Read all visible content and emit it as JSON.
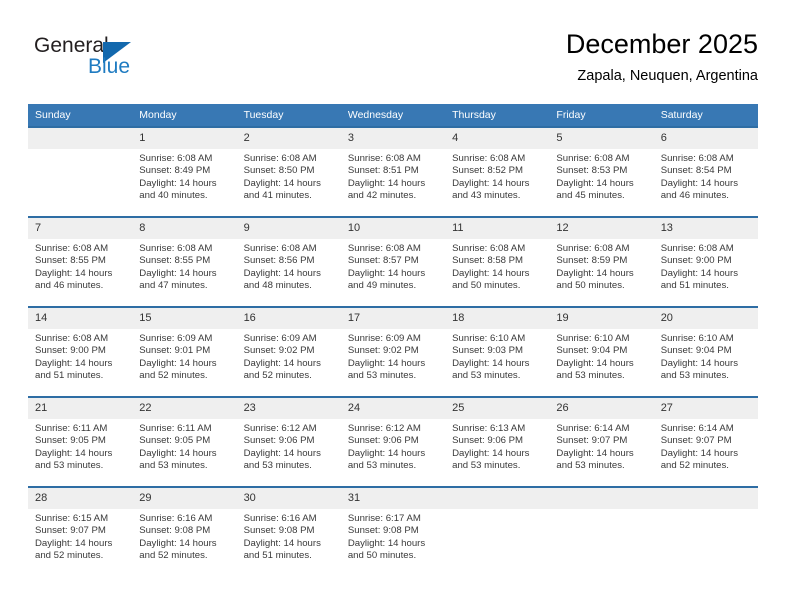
{
  "logo": {
    "word1": "General",
    "word2": "Blue",
    "triangle_color": "#1268ad",
    "blue_color": "#1f7bc1"
  },
  "header": {
    "title": "December 2025",
    "subtitle": "Zapala, Neuquen, Argentina"
  },
  "theme": {
    "header_bg": "#3878b4",
    "row_divider": "#2e6da4",
    "daynum_bg": "#efefef"
  },
  "calendar": {
    "weekday_headers": [
      "Sunday",
      "Monday",
      "Tuesday",
      "Wednesday",
      "Thursday",
      "Friday",
      "Saturday"
    ],
    "weeks": [
      [
        {
          "day": "",
          "empty": true
        },
        {
          "day": "1",
          "sunrise": "Sunrise: 6:08 AM",
          "sunset": "Sunset: 8:49 PM",
          "daylight1": "Daylight: 14 hours",
          "daylight2": "and 40 minutes."
        },
        {
          "day": "2",
          "sunrise": "Sunrise: 6:08 AM",
          "sunset": "Sunset: 8:50 PM",
          "daylight1": "Daylight: 14 hours",
          "daylight2": "and 41 minutes."
        },
        {
          "day": "3",
          "sunrise": "Sunrise: 6:08 AM",
          "sunset": "Sunset: 8:51 PM",
          "daylight1": "Daylight: 14 hours",
          "daylight2": "and 42 minutes."
        },
        {
          "day": "4",
          "sunrise": "Sunrise: 6:08 AM",
          "sunset": "Sunset: 8:52 PM",
          "daylight1": "Daylight: 14 hours",
          "daylight2": "and 43 minutes."
        },
        {
          "day": "5",
          "sunrise": "Sunrise: 6:08 AM",
          "sunset": "Sunset: 8:53 PM",
          "daylight1": "Daylight: 14 hours",
          "daylight2": "and 45 minutes."
        },
        {
          "day": "6",
          "sunrise": "Sunrise: 6:08 AM",
          "sunset": "Sunset: 8:54 PM",
          "daylight1": "Daylight: 14 hours",
          "daylight2": "and 46 minutes."
        }
      ],
      [
        {
          "day": "7",
          "sunrise": "Sunrise: 6:08 AM",
          "sunset": "Sunset: 8:55 PM",
          "daylight1": "Daylight: 14 hours",
          "daylight2": "and 46 minutes."
        },
        {
          "day": "8",
          "sunrise": "Sunrise: 6:08 AM",
          "sunset": "Sunset: 8:55 PM",
          "daylight1": "Daylight: 14 hours",
          "daylight2": "and 47 minutes."
        },
        {
          "day": "9",
          "sunrise": "Sunrise: 6:08 AM",
          "sunset": "Sunset: 8:56 PM",
          "daylight1": "Daylight: 14 hours",
          "daylight2": "and 48 minutes."
        },
        {
          "day": "10",
          "sunrise": "Sunrise: 6:08 AM",
          "sunset": "Sunset: 8:57 PM",
          "daylight1": "Daylight: 14 hours",
          "daylight2": "and 49 minutes."
        },
        {
          "day": "11",
          "sunrise": "Sunrise: 6:08 AM",
          "sunset": "Sunset: 8:58 PM",
          "daylight1": "Daylight: 14 hours",
          "daylight2": "and 50 minutes."
        },
        {
          "day": "12",
          "sunrise": "Sunrise: 6:08 AM",
          "sunset": "Sunset: 8:59 PM",
          "daylight1": "Daylight: 14 hours",
          "daylight2": "and 50 minutes."
        },
        {
          "day": "13",
          "sunrise": "Sunrise: 6:08 AM",
          "sunset": "Sunset: 9:00 PM",
          "daylight1": "Daylight: 14 hours",
          "daylight2": "and 51 minutes."
        }
      ],
      [
        {
          "day": "14",
          "sunrise": "Sunrise: 6:08 AM",
          "sunset": "Sunset: 9:00 PM",
          "daylight1": "Daylight: 14 hours",
          "daylight2": "and 51 minutes."
        },
        {
          "day": "15",
          "sunrise": "Sunrise: 6:09 AM",
          "sunset": "Sunset: 9:01 PM",
          "daylight1": "Daylight: 14 hours",
          "daylight2": "and 52 minutes."
        },
        {
          "day": "16",
          "sunrise": "Sunrise: 6:09 AM",
          "sunset": "Sunset: 9:02 PM",
          "daylight1": "Daylight: 14 hours",
          "daylight2": "and 52 minutes."
        },
        {
          "day": "17",
          "sunrise": "Sunrise: 6:09 AM",
          "sunset": "Sunset: 9:02 PM",
          "daylight1": "Daylight: 14 hours",
          "daylight2": "and 53 minutes."
        },
        {
          "day": "18",
          "sunrise": "Sunrise: 6:10 AM",
          "sunset": "Sunset: 9:03 PM",
          "daylight1": "Daylight: 14 hours",
          "daylight2": "and 53 minutes."
        },
        {
          "day": "19",
          "sunrise": "Sunrise: 6:10 AM",
          "sunset": "Sunset: 9:04 PM",
          "daylight1": "Daylight: 14 hours",
          "daylight2": "and 53 minutes."
        },
        {
          "day": "20",
          "sunrise": "Sunrise: 6:10 AM",
          "sunset": "Sunset: 9:04 PM",
          "daylight1": "Daylight: 14 hours",
          "daylight2": "and 53 minutes."
        }
      ],
      [
        {
          "day": "21",
          "sunrise": "Sunrise: 6:11 AM",
          "sunset": "Sunset: 9:05 PM",
          "daylight1": "Daylight: 14 hours",
          "daylight2": "and 53 minutes."
        },
        {
          "day": "22",
          "sunrise": "Sunrise: 6:11 AM",
          "sunset": "Sunset: 9:05 PM",
          "daylight1": "Daylight: 14 hours",
          "daylight2": "and 53 minutes."
        },
        {
          "day": "23",
          "sunrise": "Sunrise: 6:12 AM",
          "sunset": "Sunset: 9:06 PM",
          "daylight1": "Daylight: 14 hours",
          "daylight2": "and 53 minutes."
        },
        {
          "day": "24",
          "sunrise": "Sunrise: 6:12 AM",
          "sunset": "Sunset: 9:06 PM",
          "daylight1": "Daylight: 14 hours",
          "daylight2": "and 53 minutes."
        },
        {
          "day": "25",
          "sunrise": "Sunrise: 6:13 AM",
          "sunset": "Sunset: 9:06 PM",
          "daylight1": "Daylight: 14 hours",
          "daylight2": "and 53 minutes."
        },
        {
          "day": "26",
          "sunrise": "Sunrise: 6:14 AM",
          "sunset": "Sunset: 9:07 PM",
          "daylight1": "Daylight: 14 hours",
          "daylight2": "and 53 minutes."
        },
        {
          "day": "27",
          "sunrise": "Sunrise: 6:14 AM",
          "sunset": "Sunset: 9:07 PM",
          "daylight1": "Daylight: 14 hours",
          "daylight2": "and 52 minutes."
        }
      ],
      [
        {
          "day": "28",
          "sunrise": "Sunrise: 6:15 AM",
          "sunset": "Sunset: 9:07 PM",
          "daylight1": "Daylight: 14 hours",
          "daylight2": "and 52 minutes."
        },
        {
          "day": "29",
          "sunrise": "Sunrise: 6:16 AM",
          "sunset": "Sunset: 9:08 PM",
          "daylight1": "Daylight: 14 hours",
          "daylight2": "and 52 minutes."
        },
        {
          "day": "30",
          "sunrise": "Sunrise: 6:16 AM",
          "sunset": "Sunset: 9:08 PM",
          "daylight1": "Daylight: 14 hours",
          "daylight2": "and 51 minutes."
        },
        {
          "day": "31",
          "sunrise": "Sunrise: 6:17 AM",
          "sunset": "Sunset: 9:08 PM",
          "daylight1": "Daylight: 14 hours",
          "daylight2": "and 50 minutes."
        },
        {
          "day": "",
          "empty": true
        },
        {
          "day": "",
          "empty": true
        },
        {
          "day": "",
          "empty": true
        }
      ]
    ]
  }
}
